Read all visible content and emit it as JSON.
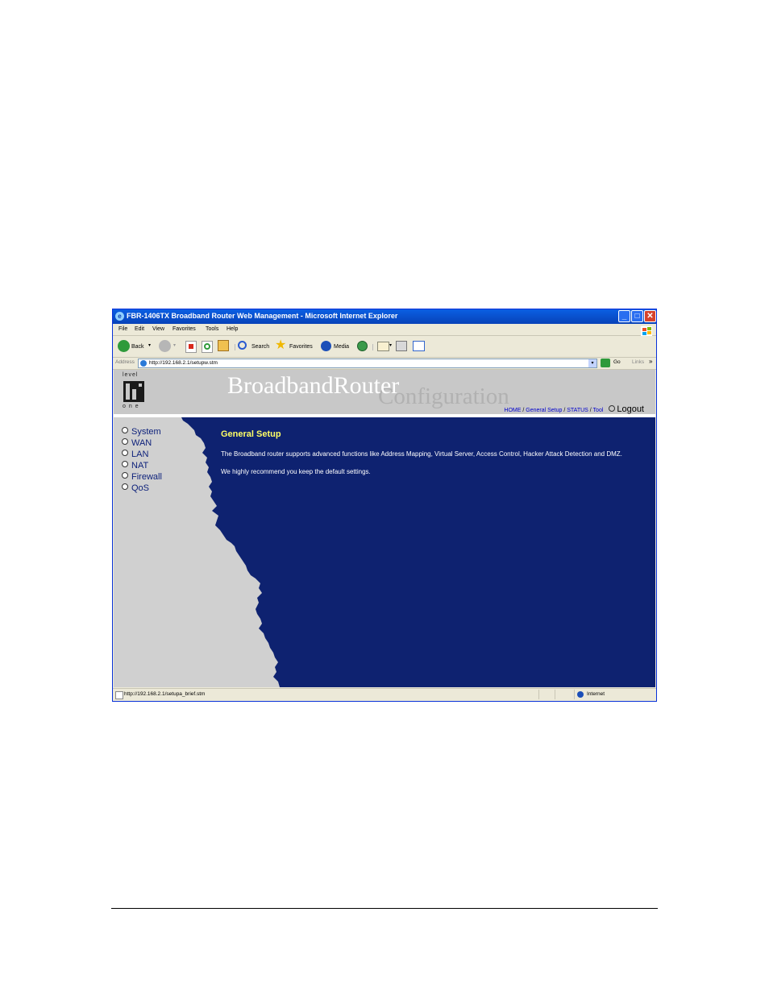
{
  "window": {
    "title": "FBR-1406TX Broadband Router Web Management - Microsoft Internet Explorer",
    "controls": {
      "minimize": "_",
      "maximize": "□",
      "close": "✕"
    }
  },
  "menu": [
    "File",
    "Edit",
    "View",
    "Favorites",
    "Tools",
    "Help"
  ],
  "toolbar": {
    "back": "Back",
    "search": "Search",
    "favorites": "Favorites",
    "media": "Media"
  },
  "address": {
    "label": "Address",
    "url": "http://192.168.2.1/setupw.stm",
    "go": "Go",
    "links": "Links"
  },
  "header": {
    "logo_top": "level",
    "logo_bottom": "one",
    "brand_line1": "BroadbandRouter",
    "brand_line2": "Configuration",
    "nav": {
      "home": "HOME",
      "general_setup": "General Setup",
      "status": "STATUS",
      "tool": "Tool",
      "logout": "Logout"
    }
  },
  "sidebar": {
    "items": [
      "System",
      "WAN",
      "LAN",
      "NAT",
      "Firewall",
      "QoS"
    ]
  },
  "main": {
    "heading": "General Setup",
    "paragraph1": "The Broadband router supports advanced functions like Address Mapping, Virtual Server, Access Control, Hacker Attack Detection and DMZ.",
    "paragraph2": "We highly recommend you keep the default settings."
  },
  "status": {
    "url": "http://192.168.2.1/setupa_brief.stm",
    "zone": "Internet"
  },
  "colors": {
    "content_bg": "#0e2270",
    "sidebar_bg": "#d0d0d0",
    "heading": "#ffff66",
    "titlebar": "#0a5fe3"
  }
}
